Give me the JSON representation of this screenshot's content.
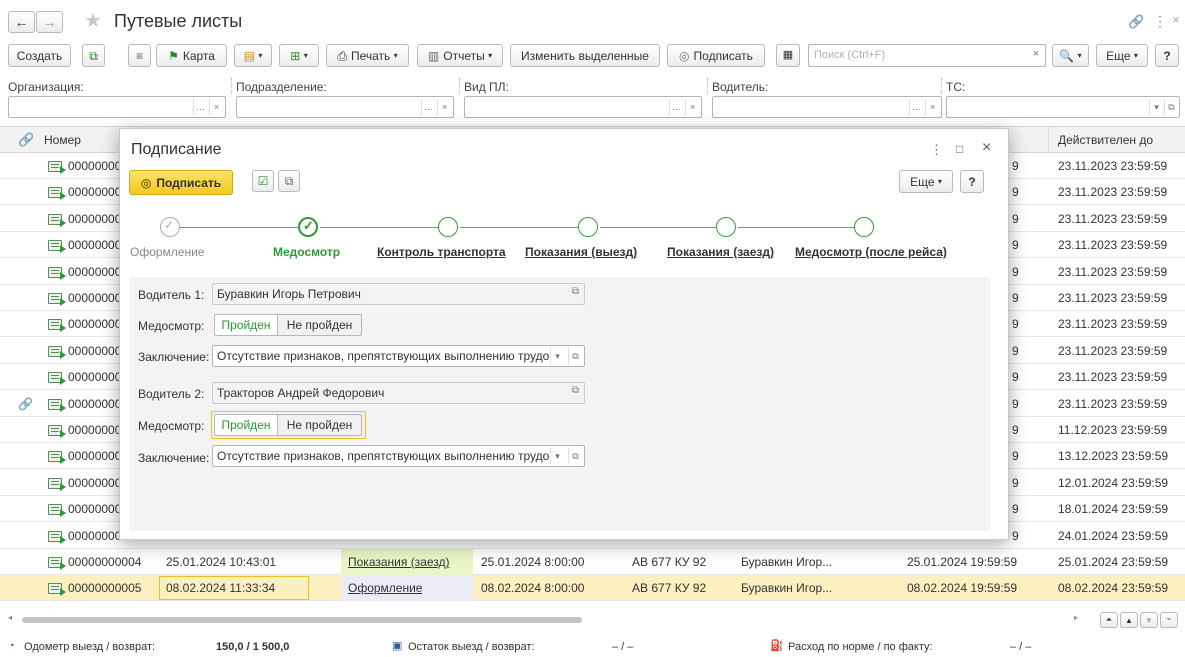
{
  "window": {
    "title": "Путевые листы"
  },
  "toolbar": {
    "create": "Создать",
    "map": "Карта",
    "print": "Печать",
    "reports": "Отчеты",
    "change_selected": "Изменить выделенные",
    "sign": "Подписать",
    "search_placeholder": "Поиск (Ctrl+F)",
    "more": "Еще",
    "help": "?"
  },
  "filters": {
    "organization": "Организация:",
    "department": "Подразделение:",
    "waybill_type": "Вид ПЛ:",
    "driver": "Водитель:",
    "vehicle": "ТС:"
  },
  "table": {
    "headers": {
      "number": "Номер",
      "valid_until": "Действителен до"
    },
    "rows": [
      {
        "number": "00000000",
        "valid_until": "23.11.2023 23:59:59",
        "attach": false
      },
      {
        "number": "00000000",
        "valid_until": "23.11.2023 23:59:59",
        "attach": false
      },
      {
        "number": "00000000",
        "valid_until": "23.11.2023 23:59:59",
        "attach": false
      },
      {
        "number": "00000000",
        "valid_until": "23.11.2023 23:59:59",
        "attach": false
      },
      {
        "number": "00000000",
        "valid_until": "23.11.2023 23:59:59",
        "attach": false
      },
      {
        "number": "00000000",
        "valid_until": "23.11.2023 23:59:59",
        "attach": false
      },
      {
        "number": "00000000",
        "valid_until": "23.11.2023 23:59:59",
        "attach": false
      },
      {
        "number": "00000000",
        "valid_until": "23.11.2023 23:59:59",
        "attach": false
      },
      {
        "number": "00000000",
        "valid_until": "23.11.2023 23:59:59",
        "attach": false
      },
      {
        "number": "00000000",
        "valid_until": "23.11.2023 23:59:59",
        "attach": true
      },
      {
        "number": "00000000",
        "valid_until": "11.12.2023 23:59:59",
        "attach": false
      },
      {
        "number": "00000000",
        "valid_until": "13.12.2023 23:59:59",
        "attach": false
      },
      {
        "number": "00000000",
        "valid_until": "12.01.2024 23:59:59",
        "attach": false
      },
      {
        "number": "00000000",
        "valid_until": "18.01.2024 23:59:59",
        "attach": false
      },
      {
        "number": "00000000",
        "valid_until": "24.01.2024 23:59:59",
        "attach": false
      }
    ],
    "full_rows": [
      {
        "number": "00000000004",
        "date": "25.01.2024 10:43:01",
        "stage": "Показания (заезд)",
        "departure": "25.01.2024 8:00:00",
        "plate": "АВ 677 КУ 92",
        "driver": "Буравкин Игор...",
        "valid_from": "25.01.2024 19:59:59",
        "valid_until": "25.01.2024 23:59:59"
      },
      {
        "number": "00000000005",
        "date": "08.02.2024 11:33:34",
        "stage": "Оформление",
        "departure": "08.02.2024 8:00:00",
        "plate": "АВ 677 КУ 92",
        "driver": "Буравкин Игор...",
        "valid_from": "08.02.2024 19:59:59",
        "valid_until": "08.02.2024 23:59:59"
      }
    ]
  },
  "dialog": {
    "title": "Подписание",
    "sign_button": "Подписать",
    "more": "Еще",
    "help": "?",
    "steps": [
      {
        "label": "Оформление",
        "state": "done-gray"
      },
      {
        "label": "Медосмотр",
        "state": "current"
      },
      {
        "label": "Контроль транспорта",
        "state": "pending"
      },
      {
        "label": "Показания (выезд)",
        "state": "pending"
      },
      {
        "label": "Показания (заезд)",
        "state": "pending"
      },
      {
        "label": "Медосмотр (после рейса)",
        "state": "pending"
      }
    ],
    "driver1": {
      "label": "Водитель 1:",
      "name": "Буравкин Игорь Петрович",
      "medical_label": "Медосмотр:",
      "passed": "Пройден",
      "not_passed": "Не пройден",
      "conclusion_label": "Заключение:",
      "conclusion": "Отсутствие признаков, препятствующих выполнению трудо"
    },
    "driver2": {
      "label": "Водитель 2:",
      "name": "Тракторов Андрей Федорович",
      "medical_label": "Медосмотр:",
      "passed": "Пройден",
      "not_passed": "Не пройден",
      "conclusion_label": "Заключение:",
      "conclusion": "Отсутствие признаков, препятствующих выполнению трудо"
    }
  },
  "statusbar": {
    "odometer_label": "Одометр выезд / возврат:",
    "odometer_value": "150,0  /  1 500,0",
    "remainder_label": "Остаток выезд / возврат:",
    "remainder_value": "–  /  –",
    "consumption_label": "Расход по норме / по факту:",
    "consumption_value": "–  /  –"
  },
  "colors": {
    "accent_yellow": "#f6d33b",
    "green": "#2a9a38",
    "selected_row": "#fdf0c0"
  }
}
